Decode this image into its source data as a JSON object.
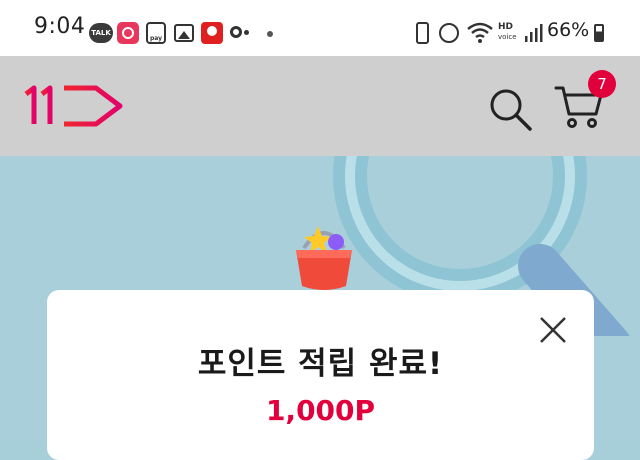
{
  "status_bar": {
    "time": "9:04",
    "talk_label": "TALK",
    "pay_label": "pay",
    "hd_label": "HD",
    "voice_label": "voice",
    "battery_percent": "66%",
    "battery_level": 0.66
  },
  "header": {
    "logo_text": "11",
    "cart_count": "7"
  },
  "modal": {
    "title": "포인트 적립 완료!",
    "points": "1,000P"
  },
  "colors": {
    "accent": "#e2003c",
    "header_bg": "#cfcfcf",
    "banner_bg": "#a9d0da"
  },
  "icons": [
    "search-icon",
    "cart-icon",
    "close-icon",
    "magnifier-illustration",
    "basket-illustration"
  ]
}
